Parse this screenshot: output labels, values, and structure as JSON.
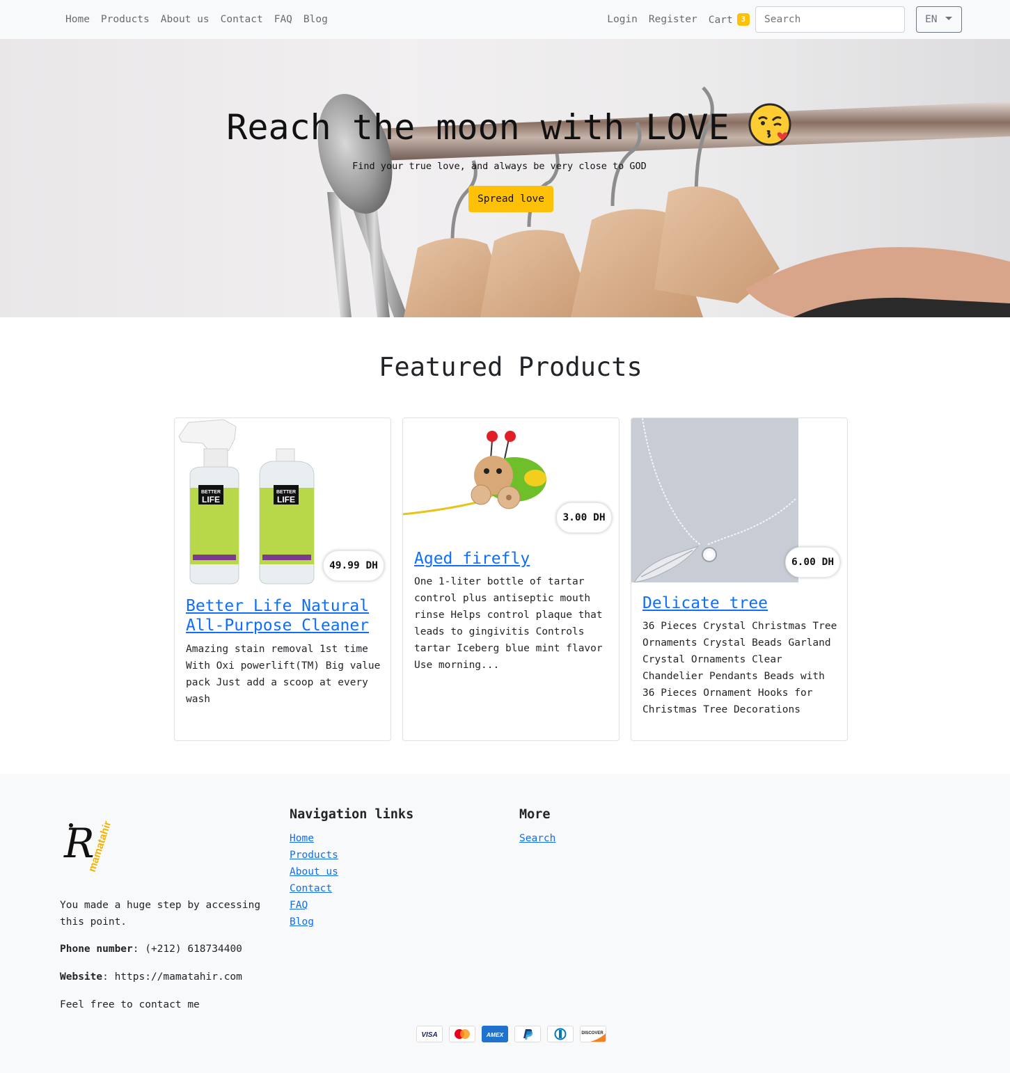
{
  "nav": {
    "links": [
      "Home",
      "Products",
      "About us",
      "Contact",
      "FAQ",
      "Blog"
    ],
    "login": "Login",
    "register": "Register",
    "cart_label": "Cart",
    "cart_count": "3",
    "search_placeholder": "Search",
    "lang": "EN"
  },
  "hero": {
    "title": "Reach the moon with LOVE",
    "subtitle": "Find your true love, and always be very close to GOD",
    "button": "Spread love",
    "emoji": "kissing-face-icon"
  },
  "featured": {
    "title": "Featured Products",
    "products": [
      {
        "title": "Better Life Natural All-Purpose Cleaner",
        "price": "49.99 DH",
        "description": "Amazing stain removal 1st time With Oxi powerlift(TM) Big value pack Just add a scoop at every wash",
        "image": "cleaner-bottles-image"
      },
      {
        "title": "Aged firefly",
        "price": "3.00 DH",
        "description": "One 1-liter bottle of tartar control plus antiseptic mouth rinse Helps control plaque that leads to gingivitis Controls tartar Iceberg blue mint flavor Use morning...",
        "image": "firefly-toy-image"
      },
      {
        "title": "Delicate tree",
        "price": "6.00 DH",
        "description": "36 Pieces Crystal Christmas Tree Ornaments Crystal Beads Garland Crystal Ornaments Clear Chandelier Pendants Beads with 36 Pieces Ornament Hooks for Christmas Tree Decorations",
        "image": "necklace-image"
      }
    ]
  },
  "footer": {
    "logo_text": "mamatahir",
    "about": "You made a huge step by accessing this point.",
    "phone_label": "Phone number",
    "phone": ": (+212) 618734400",
    "website_label": "Website",
    "website": ": https://mamatahir.com",
    "contact_note": "Feel free to contact me",
    "nav_title": "Navigation links",
    "nav_links": [
      "Home",
      "Products",
      "About us",
      "Contact",
      "FAQ",
      "Blog"
    ],
    "more_title": "More",
    "more_links": [
      "Search"
    ],
    "payments": [
      "visa",
      "mastercard",
      "amex",
      "paypal",
      "diners",
      "discover"
    ],
    "visa_text": "VISA",
    "amex_text": "AMEX",
    "discover_text": "DISCOVER"
  },
  "colors": {
    "accent": "#ffc107",
    "link": "#0d6efd",
    "navbar_bg": "#f8f9fa",
    "footer_bg": "#f8f9fa"
  }
}
